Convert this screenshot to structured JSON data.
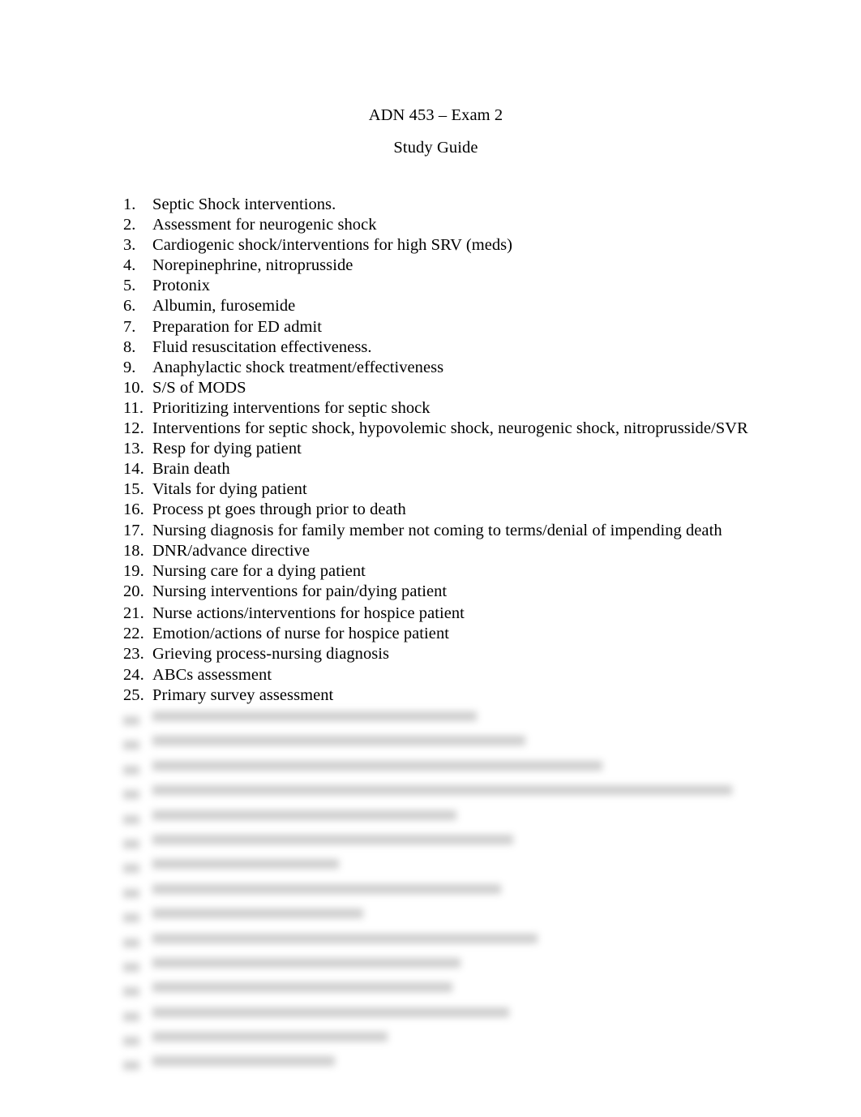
{
  "document": {
    "title": "ADN 453 – Exam 2",
    "subtitle": "Study Guide"
  },
  "study_guide": {
    "items": [
      {
        "number": "1.",
        "text": "Septic Shock interventions."
      },
      {
        "number": "2.",
        "text": "Assessment for neurogenic shock"
      },
      {
        "number": "3.",
        "text": "Cardiogenic shock/interventions for high SRV (meds)"
      },
      {
        "number": "4.",
        "text": "Norepinephrine, nitroprusside"
      },
      {
        "number": "5.",
        "text": "Protonix"
      },
      {
        "number": "6.",
        "text": "Albumin, furosemide"
      },
      {
        "number": "7.",
        "text": "Preparation for ED admit"
      },
      {
        "number": "8.",
        "text": "Fluid resuscitation effectiveness."
      },
      {
        "number": "9.",
        "text": "Anaphylactic shock treatment/effectiveness"
      },
      {
        "number": "10.",
        "text": "S/S of MODS"
      },
      {
        "number": "11.",
        "text": "Prioritizing interventions for septic shock"
      },
      {
        "number": "12.",
        "text": "Interventions for septic shock, hypovolemic shock, neurogenic shock, nitroprusside/SVR"
      },
      {
        "number": "13.",
        "text": "Resp for dying patient"
      },
      {
        "number": "14.",
        "text": "Brain death"
      },
      {
        "number": "15.",
        "text": "Vitals for dying patient"
      },
      {
        "number": "16.",
        "text": "Process pt goes through prior to death"
      },
      {
        "number": "17.",
        "text": "Nursing diagnosis for family member not coming to terms/denial of impending death"
      },
      {
        "number": "18.",
        "text": "DNR/advance directive"
      },
      {
        "number": "19.",
        "text": "Nursing care for a dying patient"
      },
      {
        "number": "20.",
        "text": "Nursing interventions for pain/dying patient"
      },
      {
        "number": "21.",
        "text": "Nurse actions/interventions for hospice patient"
      },
      {
        "number": "22.",
        "text": "Emotion/actions of nurse for hospice patient"
      },
      {
        "number": "23.",
        "text": "Grieving process-nursing diagnosis"
      },
      {
        "number": "24.",
        "text": "ABCs assessment"
      },
      {
        "number": "25.",
        "text": "Primary survey assessment"
      }
    ],
    "obscured_line_widths": [
      400,
      460,
      555,
      715,
      375,
      445,
      230,
      430,
      260,
      475,
      380,
      370,
      440,
      290,
      225
    ]
  }
}
